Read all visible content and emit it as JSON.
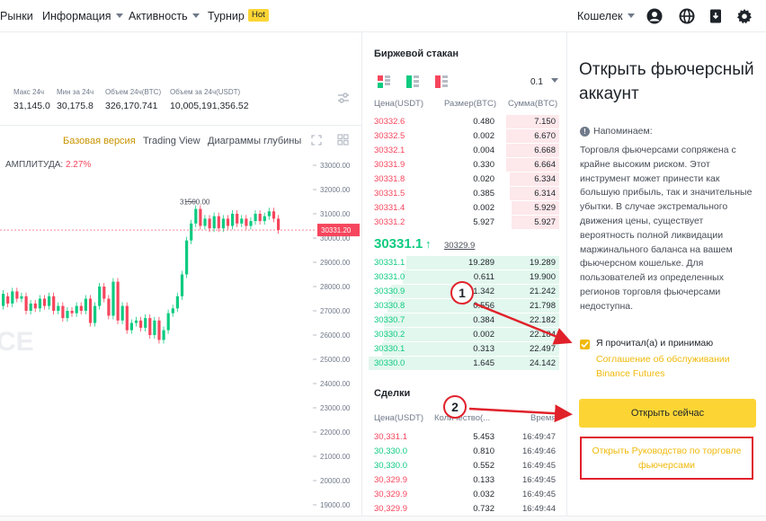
{
  "nav": {
    "items": [
      {
        "label": "Рынки",
        "dropdown": false
      },
      {
        "label": "Информация",
        "dropdown": true
      },
      {
        "label": "Активность",
        "dropdown": true
      },
      {
        "label": "Турнир",
        "dropdown": false
      }
    ],
    "hot_badge": "Hot",
    "wallet_label": "Кошелек",
    "icons": [
      "user-icon",
      "globe-icon",
      "download-icon",
      "settings-icon"
    ]
  },
  "ticker_stats": [
    {
      "label": "Макс 24ч",
      "value": "31,145.0"
    },
    {
      "label": "Мин за 24ч",
      "value": "30,175.8"
    },
    {
      "label": "Объем 24ч(BTC)",
      "value": "326,170.741"
    },
    {
      "label": "Объем за 24ч(USDT)",
      "value": "10,005,191,356.52"
    }
  ],
  "chart_tabs": [
    {
      "label": "Базовая версия",
      "active": true
    },
    {
      "label": "Trading View",
      "active": false
    },
    {
      "label": "Диаграммы глубины",
      "active": false
    }
  ],
  "amplitude": {
    "label": "АМПЛИТУДА:",
    "value": "2.27%"
  },
  "chart_data": {
    "type": "candlestick",
    "y_ticks": [
      "33000.00",
      "32000.00",
      "31000.00",
      "30000.00",
      "29000.00",
      "28000.00",
      "27000.00",
      "26000.00",
      "25000.00",
      "24000.00",
      "23000.00",
      "22000.00",
      "21000.00",
      "20000.00",
      "19000.00"
    ],
    "high_label": "31500.00",
    "last_price_label": "30331.20",
    "watermark": "CE",
    "accent_colors": {
      "up": "#0ecb81",
      "down": "#f6465d"
    }
  },
  "order_book": {
    "title": "Биржевой стакан",
    "precision": "0.1",
    "headers": {
      "price": "Цена(USDT)",
      "size": "Размер(BTC)",
      "sum": "Сумма(BTC)"
    },
    "asks": [
      {
        "price": "30332.6",
        "size": "0.480",
        "sum": "7.150",
        "depth": 0.28
      },
      {
        "price": "30332.5",
        "size": "0.002",
        "sum": "6.670",
        "depth": 0.28
      },
      {
        "price": "30332.1",
        "size": "0.004",
        "sum": "6.668",
        "depth": 0.28
      },
      {
        "price": "30331.9",
        "size": "0.330",
        "sum": "6.664",
        "depth": 0.28
      },
      {
        "price": "30331.8",
        "size": "0.020",
        "sum": "6.334",
        "depth": 0.26
      },
      {
        "price": "30331.5",
        "size": "0.385",
        "sum": "6.314",
        "depth": 0.26
      },
      {
        "price": "30331.4",
        "size": "0.002",
        "sum": "5.929",
        "depth": 0.25
      },
      {
        "price": "30331.2",
        "size": "5.927",
        "sum": "5.927",
        "depth": 0.25
      }
    ],
    "mid_price": "30331.1",
    "mid_arrow": "↑",
    "mark_price": "30329.9",
    "bids": [
      {
        "price": "30331.1",
        "size": "19.289",
        "sum": "19.289",
        "depth": 0.8
      },
      {
        "price": "30331.0",
        "size": "0.611",
        "sum": "19.900",
        "depth": 0.82
      },
      {
        "price": "30330.9",
        "size": "1.342",
        "sum": "21.242",
        "depth": 0.88
      },
      {
        "price": "30330.8",
        "size": "0.556",
        "sum": "21.798",
        "depth": 0.9
      },
      {
        "price": "30330.7",
        "size": "0.384",
        "sum": "22.182",
        "depth": 0.92
      },
      {
        "price": "30330.2",
        "size": "0.002",
        "sum": "22.184",
        "depth": 0.92
      },
      {
        "price": "30330.1",
        "size": "0.313",
        "sum": "22.497",
        "depth": 0.93
      },
      {
        "price": "30330.0",
        "size": "1.645",
        "sum": "24.142",
        "depth": 1.0
      }
    ]
  },
  "trades": {
    "title": "Сделки",
    "headers": {
      "price": "Цена(USDT)",
      "qty": "Количество(...",
      "time": "Время"
    },
    "rows": [
      {
        "price": "30,331.1",
        "qty": "5.453",
        "time": "16:49:47",
        "side": "sell"
      },
      {
        "price": "30,330.0",
        "qty": "0.810",
        "time": "16:49:46",
        "side": "buy"
      },
      {
        "price": "30,330.0",
        "qty": "0.552",
        "time": "16:49:45",
        "side": "buy"
      },
      {
        "price": "30,329.9",
        "qty": "0.133",
        "time": "16:49:45",
        "side": "sell"
      },
      {
        "price": "30,329.9",
        "qty": "0.032",
        "time": "16:49:45",
        "side": "sell"
      },
      {
        "price": "30,329.9",
        "qty": "0.732",
        "time": "16:49:44",
        "side": "sell"
      }
    ]
  },
  "right_panel": {
    "title": "Открыть фьючерсный аккаунт",
    "note_title": "Напоминаем:",
    "note_text": "Торговля фьючерсами сопряжена с крайне высоким риском. Этот инструмент может принести как большую прибыль, так и значительные убытки. В случае экстремального движения цены, существует вероятность полной ликвидации маржинального баланса на вашем фьючерсном кошельке. Для пользователей из определенных регионов торговля фьючерсами недоступна.",
    "agree_label": "Я прочитал(а) и принимаю",
    "agree_link": "Соглашение об обслуживании Binance Futures",
    "agreed": true,
    "open_button": "Открыть сейчас",
    "guide_link": "Открыть Руководство по торговле фьючерсами"
  },
  "annotations": {
    "step1": "1",
    "step2": "2",
    "color": "#e0212a"
  }
}
